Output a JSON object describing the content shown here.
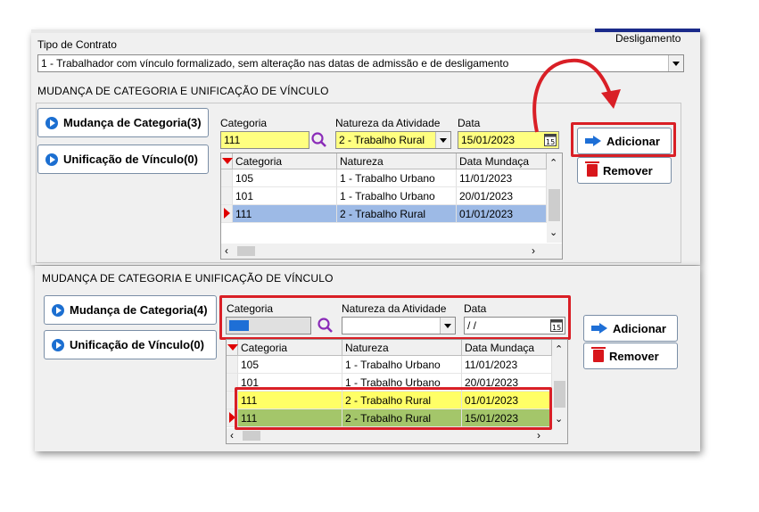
{
  "top_panel": {
    "contract_label": "Tipo de Contrato",
    "desligamento_label": "Desligamento",
    "contract_value": "1 - Trabalhador com vínculo formalizado, sem alteração nas datas de admissão e de desligamento",
    "section_title": "MUDANÇA DE CATEGORIA E UNIFICAÇÃO DE VÍNCULO",
    "mudanca_button": "Mudança de Categoria(3)",
    "unificacao_button": "Unificação de Vínculo(0)",
    "categoria_label": "Categoria",
    "natureza_label": "Natureza da Atividade",
    "data_label": "Data",
    "categoria_value": "111",
    "natureza_value": "2 - Trabalho Rural",
    "data_value": "15/01/2023",
    "adicionar_button": "Adicionar",
    "remover_button": "Remover",
    "grid_headers": [
      "Categoria",
      "Natureza",
      "Data Mundaça"
    ],
    "rows": [
      [
        "105",
        "1 - Trabalho Urbano",
        "11/01/2023"
      ],
      [
        "101",
        "1 - Trabalho Urbano",
        "20/01/2023"
      ],
      [
        "111",
        "2 - Trabalho Rural",
        "01/01/2023"
      ]
    ]
  },
  "bottom_panel": {
    "section_title": "MUDANÇA DE CATEGORIA E UNIFICAÇÃO DE VÍNCULO",
    "mudanca_button": "Mudança de Categoria(4)",
    "unificacao_button": "Unificação de Vínculo(0)",
    "categoria_label": "Categoria",
    "natureza_label": "Natureza da Atividade",
    "data_label": "Data",
    "categoria_value": "",
    "natureza_value": "",
    "data_value": " / /",
    "adicionar_button": "Adicionar",
    "remover_button": "Remover",
    "grid_headers": [
      "Categoria",
      "Natureza",
      "Data Mundaça"
    ],
    "rows": [
      [
        "105",
        "1 - Trabalho Urbano",
        "11/01/2023"
      ],
      [
        "101",
        "1 - Trabalho Urbano",
        "20/01/2023"
      ],
      [
        "111",
        "2 - Trabalho Rural",
        "01/01/2023"
      ],
      [
        "111",
        "2 - Trabalho Rural",
        "15/01/2023"
      ]
    ]
  },
  "colors": {
    "highlight_red": "#d91f26",
    "selected_row": "#9dbae6",
    "yellow_row": "#ffff66",
    "green_row": "#a4c66a",
    "input_yellow": "#ffff80",
    "icon_blue": "#1e6fd6"
  },
  "icons": [
    "play-icon",
    "search-icon",
    "calendar-icon",
    "dropdown-arrow-icon",
    "add-arrow-icon",
    "trash-icon",
    "row-pointer-icon",
    "sort-triangle-icon",
    "curved-arrow-icon"
  ]
}
